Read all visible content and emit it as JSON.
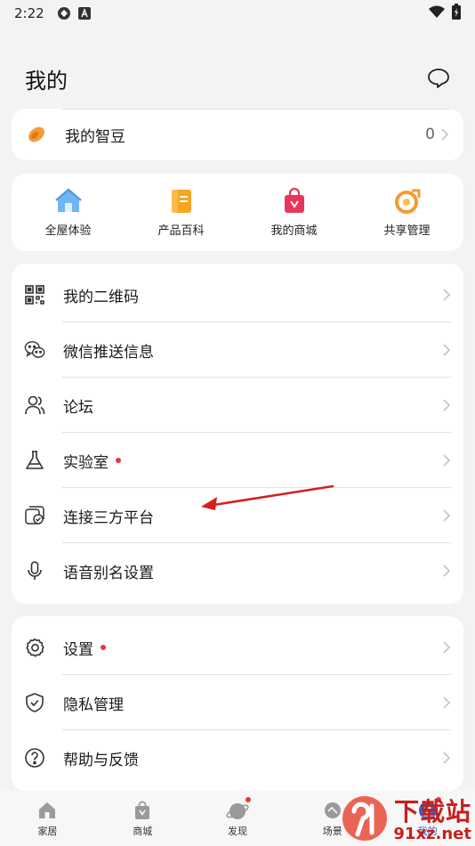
{
  "status_bar": {
    "time": "2:22"
  },
  "header": {
    "title": "我的"
  },
  "bean_row": {
    "label": "我的智豆",
    "value": "0"
  },
  "quick_actions": [
    {
      "label": "全屋体验",
      "icon": "house-icon",
      "color": "#5aa8f0"
    },
    {
      "label": "产品百科",
      "icon": "book-icon",
      "color": "#f5a623"
    },
    {
      "label": "我的商城",
      "icon": "shopping-bag-icon",
      "color": "#e8365a"
    },
    {
      "label": "共享管理",
      "icon": "share-icon",
      "color": "#f29b38"
    }
  ],
  "menu_group_1": [
    {
      "label": "我的二维码",
      "icon": "qr-code-icon",
      "dot": false
    },
    {
      "label": "微信推送信息",
      "icon": "wechat-icon",
      "dot": false
    },
    {
      "label": "论坛",
      "icon": "forum-icon",
      "dot": false
    },
    {
      "label": "实验室",
      "icon": "flask-icon",
      "dot": true
    },
    {
      "label": "连接三方平台",
      "icon": "third-party-icon",
      "dot": false
    },
    {
      "label": "语音别名设置",
      "icon": "microphone-icon",
      "dot": false
    }
  ],
  "menu_group_2": [
    {
      "label": "设置",
      "icon": "gear-icon",
      "dot": true
    },
    {
      "label": "隐私管理",
      "icon": "shield-icon",
      "dot": false
    },
    {
      "label": "帮助与反馈",
      "icon": "help-icon",
      "dot": false
    }
  ],
  "tabs": [
    {
      "label": "家居",
      "icon": "home-tab-icon"
    },
    {
      "label": "商城",
      "icon": "store-tab-icon"
    },
    {
      "label": "发现",
      "icon": "discover-tab-icon"
    },
    {
      "label": "场景",
      "icon": "scene-tab-icon"
    },
    {
      "label": "我的",
      "icon": "me-tab-icon"
    }
  ],
  "watermark": {
    "cn": "下载站",
    "en": "91xz.net"
  },
  "colors": {
    "accent": "#e8363a",
    "background": "#f1f3f5",
    "card": "#ffffff",
    "divider": "#e2e2e2"
  }
}
